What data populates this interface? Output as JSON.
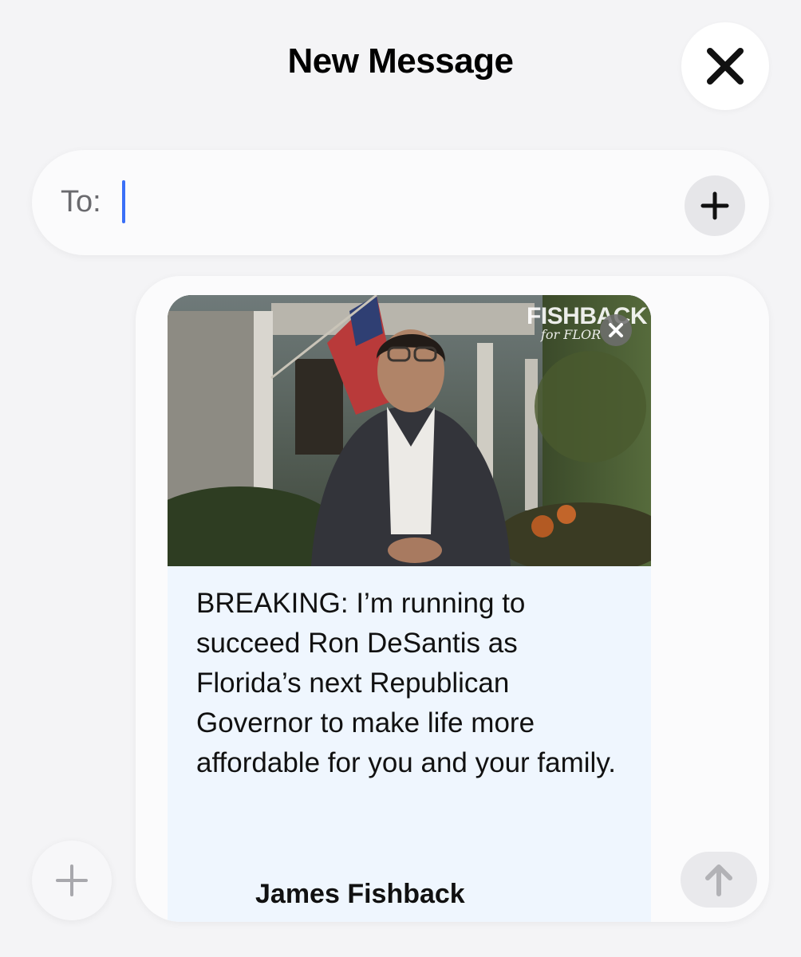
{
  "header": {
    "title": "New Message",
    "close_icon": "close-icon"
  },
  "to_field": {
    "label": "To:",
    "value": "",
    "add_icon": "plus-icon"
  },
  "message": {
    "attachment": {
      "brand_main": "FISHBACK",
      "brand_sub": "for FLOR",
      "remove_icon": "close-small-icon"
    },
    "body": "BREAKING: I’m running to succeed Ron DeSantis as Florida’s next Republican Governor to make life more affordable for you and your family.",
    "signature": "James Fishback"
  },
  "composer": {
    "apps_icon": "plus-icon",
    "send_icon": "arrow-up-icon"
  },
  "colors": {
    "caret": "#3a6ff7",
    "card_background": "#eff6fe"
  }
}
